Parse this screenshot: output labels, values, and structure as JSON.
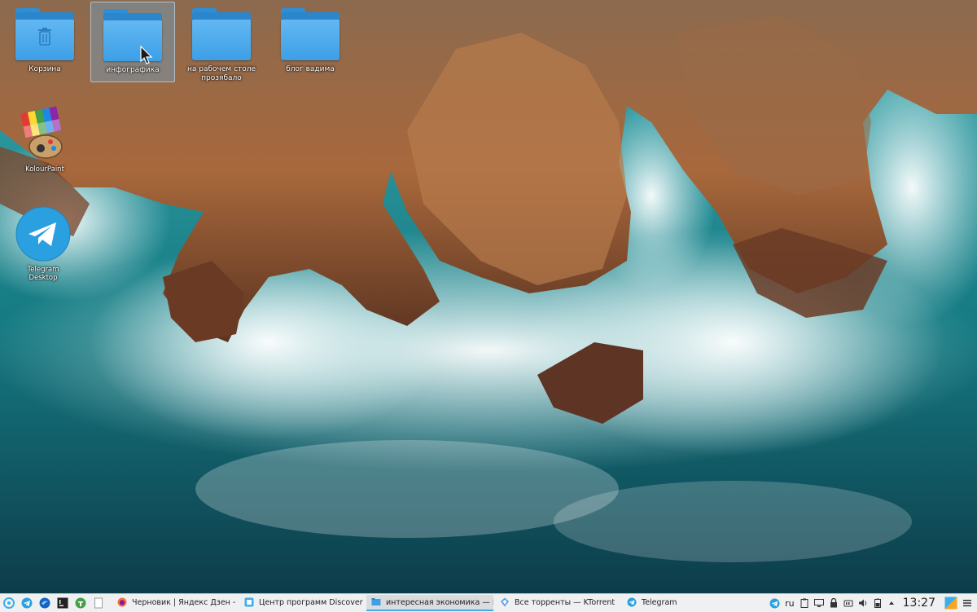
{
  "desktop": {
    "icons": [
      {
        "label": "Корзина",
        "icon": "trash-icon"
      },
      {
        "label": "инфографика",
        "icon": "folder-icon"
      },
      {
        "label": "на рабочем столе прозябало",
        "icon": "folder-icon"
      },
      {
        "label": "блог вадима",
        "icon": "folder-icon"
      }
    ],
    "apps": [
      {
        "label": "KolourPaint",
        "icon": "kolourpaint-icon"
      },
      {
        "label": "Telegram Desktop",
        "icon": "telegram-icon"
      }
    ]
  },
  "taskbar": {
    "tasks": [
      {
        "label": "Черновик | Яндекс Дзен - Mozill...",
        "icon": "firefox-icon"
      },
      {
        "label": "Центр программ Discover",
        "icon": "discover-icon"
      },
      {
        "label": "интересная экономика — Dolph...",
        "icon": "dolphin-icon"
      },
      {
        "label": "Все торренты — KTorrent",
        "icon": "ktorrent-icon"
      },
      {
        "label": "Telegram",
        "icon": "telegram-icon"
      }
    ],
    "tray": {
      "keyboard_layout": "ru",
      "clock": "13:27"
    }
  },
  "colors": {
    "taskbar_bg": "#eff0f1",
    "accent": "#3daee9",
    "folder": "#3d9fe6"
  }
}
